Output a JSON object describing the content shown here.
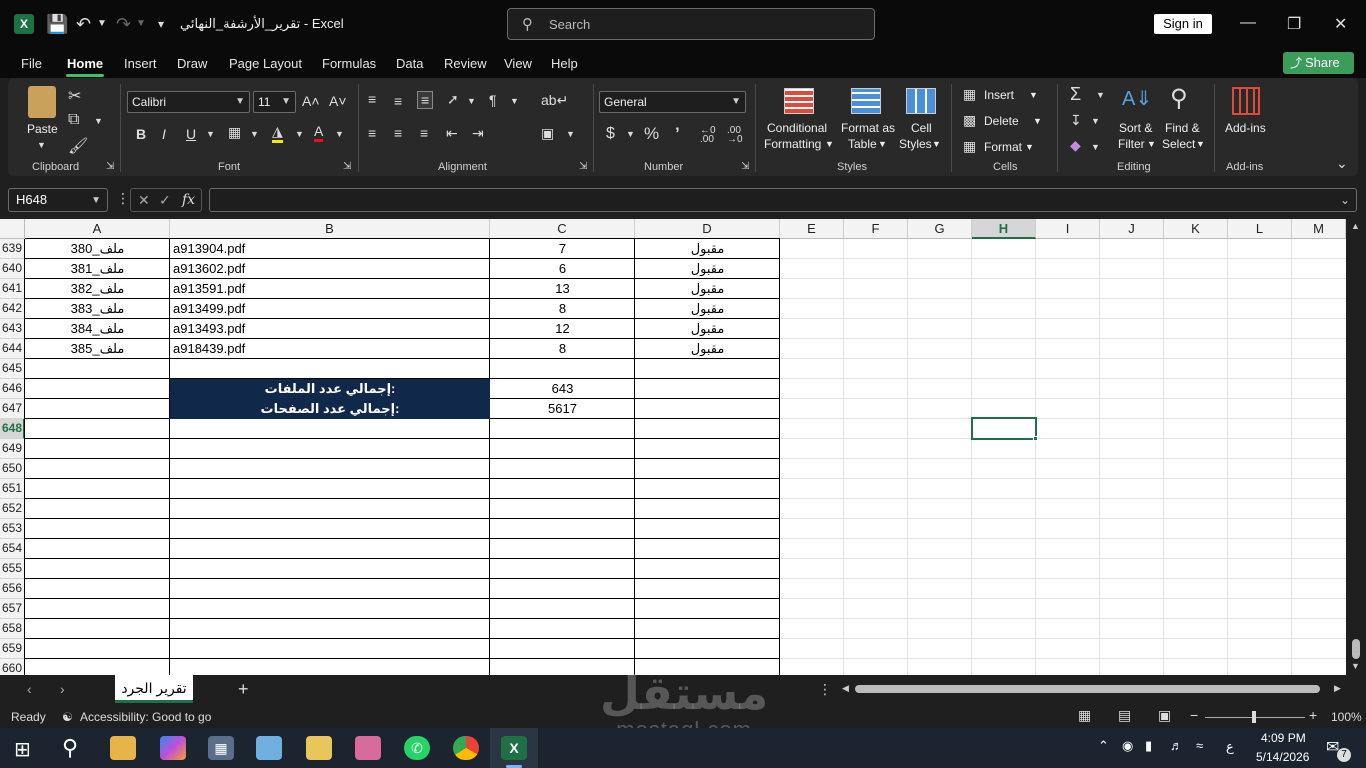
{
  "app": {
    "title": "تقرير_الأرشفة_النهائي  -  Excel",
    "search_placeholder": "Search",
    "sign_in": "Sign in",
    "share": "Share"
  },
  "menu": [
    "File",
    "Home",
    "Insert",
    "Draw",
    "Page Layout",
    "Formulas",
    "Data",
    "Review",
    "View",
    "Help"
  ],
  "ribbon": {
    "clipboard": {
      "paste": "Paste",
      "label": "Clipboard"
    },
    "font": {
      "name": "Calibri",
      "size": "11",
      "label": "Font",
      "bold": "B",
      "italic": "I",
      "underline": "U"
    },
    "alignment": {
      "label": "Alignment"
    },
    "number": {
      "format": "General",
      "label": "Number",
      "currency": "$",
      "percent": "%"
    },
    "styles": {
      "conditional": "Conditional\nFormatting",
      "conditional_l1": "Conditional",
      "conditional_l2": "Formatting",
      "format_table_l1": "Format as",
      "format_table_l2": "Table",
      "cell_styles_l1": "Cell",
      "cell_styles_l2": "Styles",
      "label": "Styles"
    },
    "cells": {
      "insert": "Insert",
      "delete": "Delete",
      "format": "Format",
      "label": "Cells"
    },
    "editing": {
      "sort_l1": "Sort &",
      "sort_l2": "Filter",
      "find_l1": "Find &",
      "find_l2": "Select",
      "label": "Editing"
    },
    "addins": {
      "button": "Add-ins",
      "label": "Add-ins"
    }
  },
  "formula_bar": {
    "name_box": "H648",
    "fx": "fx",
    "value": ""
  },
  "columns": [
    "A",
    "B",
    "C",
    "D",
    "E",
    "F",
    "G",
    "H",
    "I",
    "J",
    "K",
    "L",
    "M"
  ],
  "selected_column": "H",
  "rows": [
    "639",
    "640",
    "641",
    "642",
    "643",
    "644",
    "645",
    "646",
    "647",
    "648",
    "649",
    "650",
    "651",
    "652",
    "653",
    "654",
    "655",
    "656",
    "657",
    "658",
    "659",
    "660"
  ],
  "selected_row": "648",
  "table_rows": [
    {
      "a": "ملف_380",
      "b": "a913904.pdf",
      "c": "7",
      "d": "مقبول"
    },
    {
      "a": "ملف_381",
      "b": "a913602.pdf",
      "c": "6",
      "d": "مقبول"
    },
    {
      "a": "ملف_382",
      "b": "a913591.pdf",
      "c": "13",
      "d": "مقبول"
    },
    {
      "a": "ملف_383",
      "b": "a913499.pdf",
      "c": "8",
      "d": "مقبول"
    },
    {
      "a": "ملف_384",
      "b": "a913493.pdf",
      "c": "12",
      "d": "مقبول"
    },
    {
      "a": "ملف_385",
      "b": "a918439.pdf",
      "c": "8",
      "d": "مقبول"
    }
  ],
  "totals": [
    {
      "label": "إجمالي عدد الملفات:",
      "value": "643"
    },
    {
      "label": "إجمالي عدد الصفحات:",
      "value": "5617"
    }
  ],
  "sheet_tab": "تقرير الجرد",
  "status": {
    "ready": "Ready",
    "accessibility": "Accessibility: Good to go",
    "zoom": "100%"
  },
  "taskbar": {
    "time": "4:09 PM",
    "date": "5/14/2026",
    "lang": "ع",
    "notif": "7"
  },
  "watermark": {
    "arabic": "مستقل",
    "latin": "mostaql.com"
  }
}
